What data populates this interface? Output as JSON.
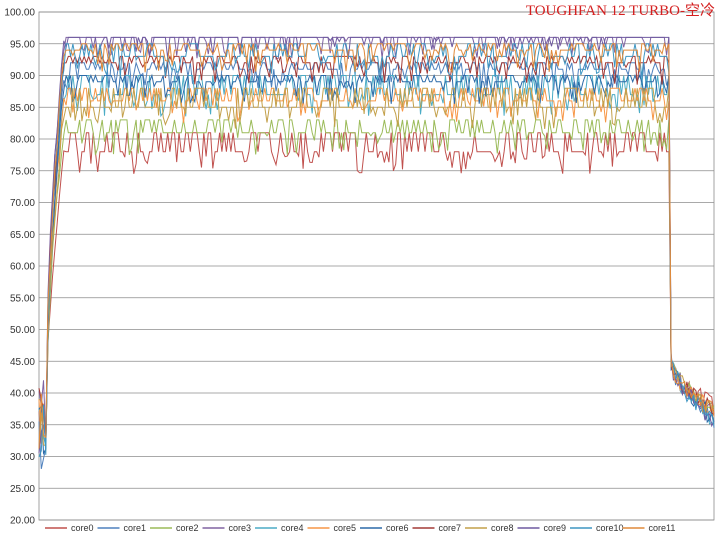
{
  "chart_data": {
    "type": "line",
    "title": "TOUGHFAN 12 TURBO-空冷",
    "xlabel": "",
    "ylabel": "",
    "ylim": [
      20,
      100
    ],
    "yticks": [
      "20.00",
      "25.00",
      "30.00",
      "35.00",
      "40.00",
      "45.00",
      "50.00",
      "55.00",
      "60.00",
      "65.00",
      "70.00",
      "75.00",
      "80.00",
      "85.00",
      "90.00",
      "95.00",
      "100.00"
    ],
    "grid": true,
    "legend_position": "bottom",
    "x_count": 300,
    "ramp_end_index": 12,
    "drop_index": 280,
    "series": [
      {
        "name": "core0",
        "color": "#c0504d",
        "start": 35,
        "plateau": 78,
        "jitter_high": 81,
        "end": 38
      },
      {
        "name": "core1",
        "color": "#4f81bd",
        "start": 33,
        "plateau": 91,
        "jitter_high": 92,
        "end": 36
      },
      {
        "name": "core2",
        "color": "#9bbb59",
        "start": 36,
        "plateau": 81,
        "jitter_high": 83,
        "end": 37
      },
      {
        "name": "core3",
        "color": "#8064a2",
        "start": 37,
        "plateau": 96,
        "jitter_high": 96,
        "end": 37
      },
      {
        "name": "core4",
        "color": "#4bacc6",
        "start": 34,
        "plateau": 87,
        "jitter_high": 90,
        "end": 36
      },
      {
        "name": "core5",
        "color": "#f79646",
        "start": 35,
        "plateau": 86,
        "jitter_high": 88,
        "end": 37
      },
      {
        "name": "core6",
        "color": "#2c6aa8",
        "start": 33,
        "plateau": 89,
        "jitter_high": 90,
        "end": 36
      },
      {
        "name": "core7",
        "color": "#a33a36",
        "start": 36,
        "plateau": 92,
        "jitter_high": 93,
        "end": 37
      },
      {
        "name": "core8",
        "color": "#c3a04a",
        "start": 36,
        "plateau": 85,
        "jitter_high": 88,
        "end": 37
      },
      {
        "name": "core9",
        "color": "#6f5aa0",
        "start": 35,
        "plateau": 96,
        "jitter_high": 96,
        "end": 36
      },
      {
        "name": "core10",
        "color": "#3f96c2",
        "start": 34,
        "plateau": 93,
        "jitter_high": 95,
        "end": 36
      },
      {
        "name": "core11",
        "color": "#e08a3a",
        "start": 35,
        "plateau": 94,
        "jitter_high": 95,
        "end": 37
      }
    ]
  }
}
